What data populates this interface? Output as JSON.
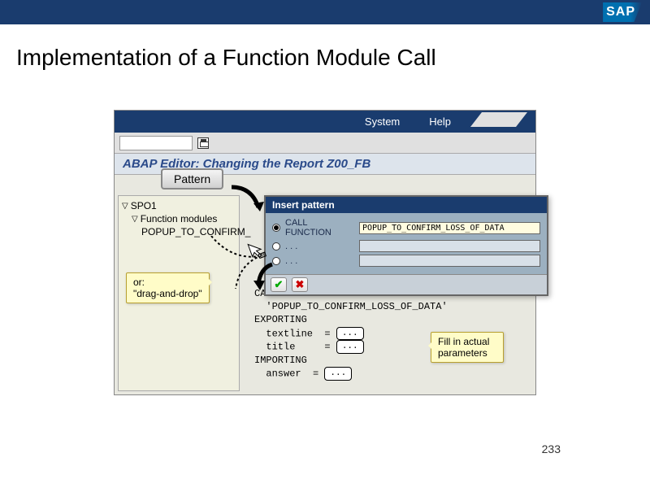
{
  "slide": {
    "title": "Implementation of a Function Module Call",
    "page_number": "233"
  },
  "logo": {
    "text": "SAP"
  },
  "window": {
    "menu": {
      "system": "System",
      "help": "Help"
    },
    "title": "ABAP Editor: Changing the Report  Z00_FB",
    "pattern_button": "Pattern"
  },
  "tree": {
    "root": "SPO1",
    "group": "Function modules",
    "item": "POPUP_TO_CONFIRM_"
  },
  "dialog": {
    "title": "Insert pattern",
    "row1_label": "CALL FUNCTION",
    "row1_value": "POPUP_TO_CONFIRM_LOSS_OF_DATA",
    "placeholder": ". . ."
  },
  "code": {
    "l1": "CALL FUNCTION",
    "l2": "  'POPUP_TO_CONFIRM_LOSS_OF_DATA'",
    "l3": "EXPORTING",
    "l4a": "  textline  = ",
    "l4b": "...",
    "l5a": "  title     = ",
    "l5b": "...",
    "l6": "IMPORTING",
    "l7a": "  answer  = ",
    "l7b": "..."
  },
  "callouts": {
    "drag1": "or:",
    "drag2": "\"drag-and-drop\"",
    "fill": "Fill in actual parameters"
  }
}
